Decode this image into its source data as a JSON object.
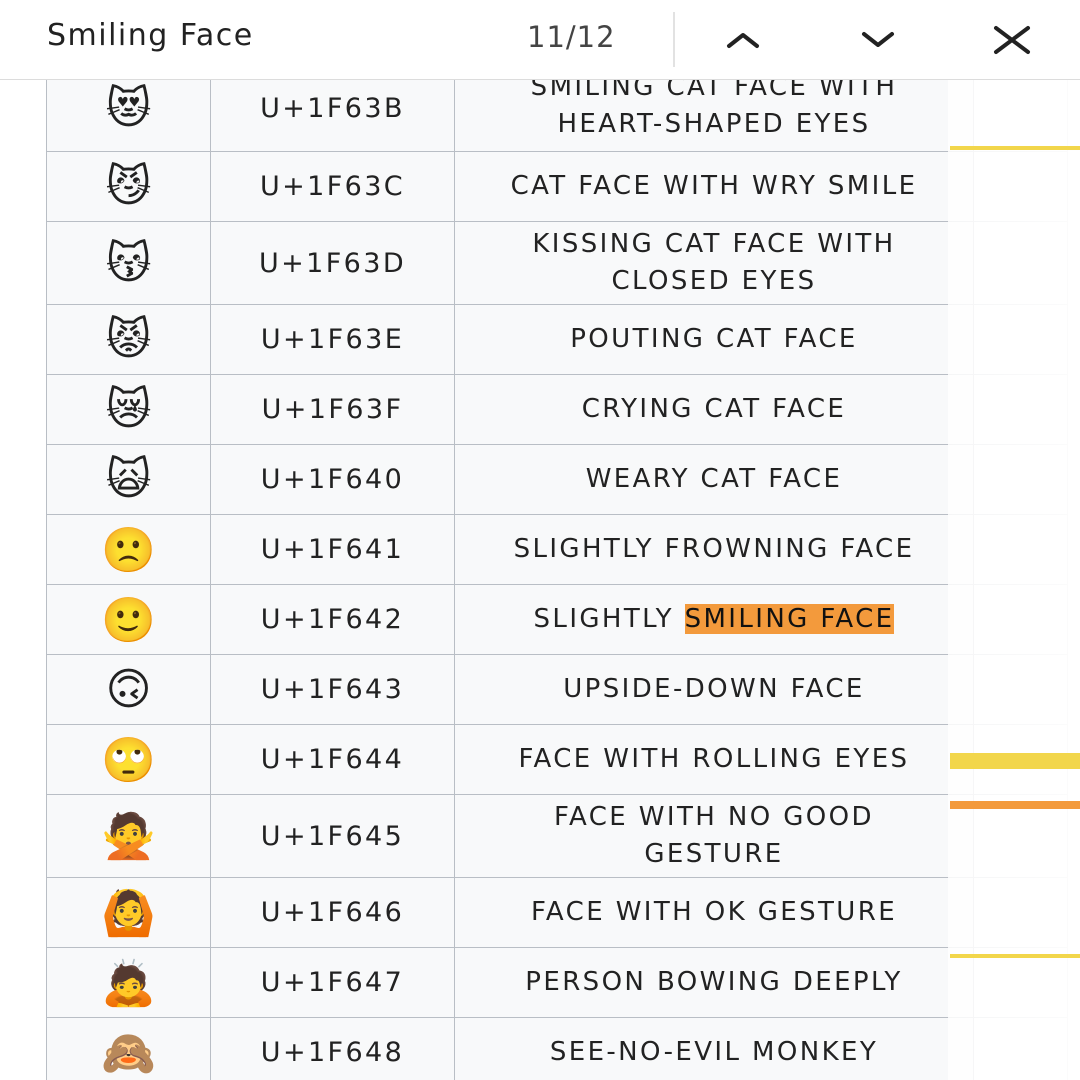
{
  "find_bar": {
    "query": "Smiling Face",
    "match_count": "11/12",
    "icons": {
      "previous": "chevron-up-icon",
      "next": "chevron-down-icon",
      "close": "close-icon"
    }
  },
  "rows": [
    {
      "emoji": "😻",
      "code": "U+1F63B",
      "name_line1": "SMILING CAT FACE WITH",
      "name_line2": "HEART-SHAPED EYES"
    },
    {
      "emoji": "😼",
      "code": "U+1F63C",
      "name_line1": "CAT FACE WITH WRY SMILE",
      "name_line2": ""
    },
    {
      "emoji": "😽",
      "code": "U+1F63D",
      "name_line1": "KISSING CAT FACE WITH",
      "name_line2": "CLOSED EYES"
    },
    {
      "emoji": "😾",
      "code": "U+1F63E",
      "name_line1": "POUTING CAT FACE",
      "name_line2": ""
    },
    {
      "emoji": "😿",
      "code": "U+1F63F",
      "name_line1": "CRYING CAT FACE",
      "name_line2": ""
    },
    {
      "emoji": "🙀",
      "code": "U+1F640",
      "name_line1": "WEARY CAT FACE",
      "name_line2": ""
    },
    {
      "emoji": "🙁",
      "code": "U+1F641",
      "name_line1": "SLIGHTLY FROWNING FACE",
      "name_line2": ""
    },
    {
      "emoji": "🙂",
      "code": "U+1F642",
      "name_prefix": "SLIGHTLY ",
      "name_match": "SMILING FACE"
    },
    {
      "emoji": "🙃",
      "code": "U+1F643",
      "name_line1": "UPSIDE-DOWN FACE",
      "name_line2": ""
    },
    {
      "emoji": "🙄",
      "code": "U+1F644",
      "name_line1": "FACE WITH ROLLING EYES",
      "name_line2": ""
    },
    {
      "emoji": "🙅",
      "code": "U+1F645",
      "name_line1": "FACE WITH NO GOOD",
      "name_line2": "GESTURE"
    },
    {
      "emoji": "🙆",
      "code": "U+1F646",
      "name_line1": "FACE WITH OK GESTURE",
      "name_line2": ""
    },
    {
      "emoji": "🙇",
      "code": "U+1F647",
      "name_line1": "PERSON BOWING DEEPLY",
      "name_line2": ""
    },
    {
      "emoji": "🙈",
      "code": "U+1F648",
      "name_line1": "SEE-NO-EVIL MONKEY",
      "name_line2": ""
    }
  ],
  "colors": {
    "active_match": "#f39a3c",
    "other_match_marker": "#f2d64b",
    "active_match_marker": "#f39a3c"
  }
}
